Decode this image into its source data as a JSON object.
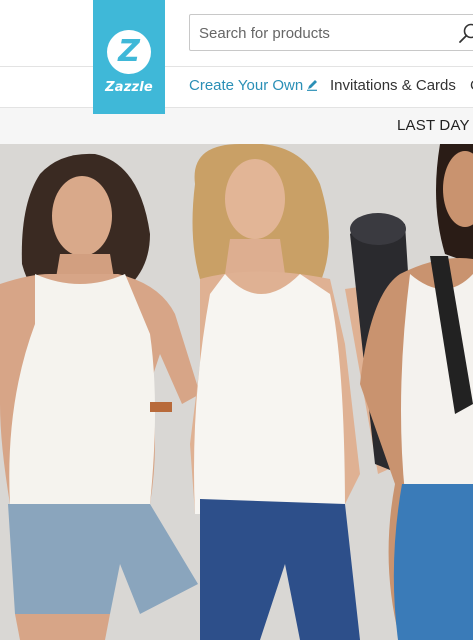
{
  "brand": {
    "logo_letter": "Z",
    "logo_text": "Zazzle",
    "color": "#3fb8d8"
  },
  "search": {
    "placeholder": "Search for products",
    "icon": "search-icon"
  },
  "nav": {
    "create_label": "Create Your Own",
    "create_icon": "pencil-icon",
    "invitations_label": "Invitations & Cards",
    "more_label": "C"
  },
  "promo": {
    "text": "LAST DAY"
  },
  "hero": {
    "image": "three-women-in-white-tank-tops-photo",
    "background": "#d9d7d4"
  }
}
